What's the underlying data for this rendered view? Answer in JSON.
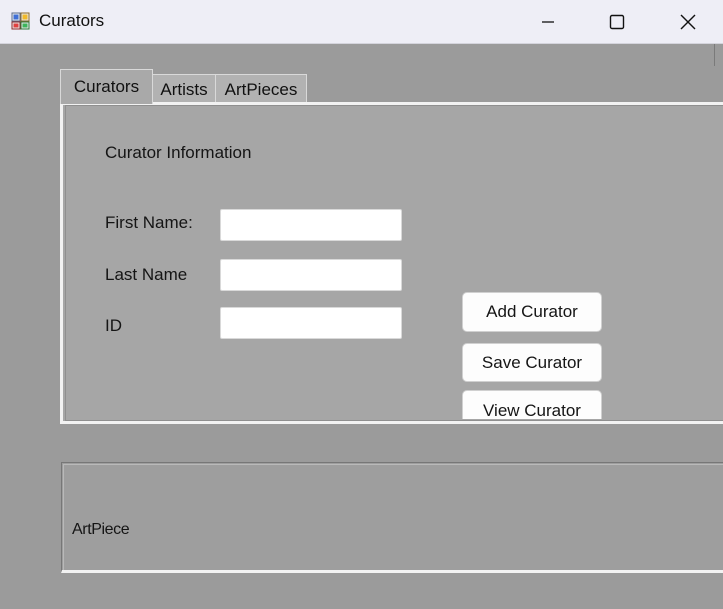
{
  "window": {
    "title": "Curators",
    "icon": "app-forms-icon",
    "controls": {
      "minimize": "minimize-icon",
      "maximize": "maximize-icon",
      "close": "close-icon"
    }
  },
  "tabs": [
    {
      "label": "Curators",
      "active": true
    },
    {
      "label": "Artists",
      "active": false
    },
    {
      "label": "ArtPieces",
      "active": false
    }
  ],
  "curator_form": {
    "section_title": "Curator Information",
    "first_name_label": "First Name:",
    "first_name_value": "",
    "last_name_label": "Last Name",
    "last_name_value": "",
    "id_label": "ID",
    "id_value": "",
    "add_button": "Add Curator",
    "save_button": "Save Curator",
    "view_button": "View Curator"
  },
  "groupbox": {
    "label": "ArtPiece"
  },
  "colors": {
    "background": "#9b9b9b",
    "titlebar": "#eeeef6",
    "tab_page": "#a6a6a6"
  }
}
